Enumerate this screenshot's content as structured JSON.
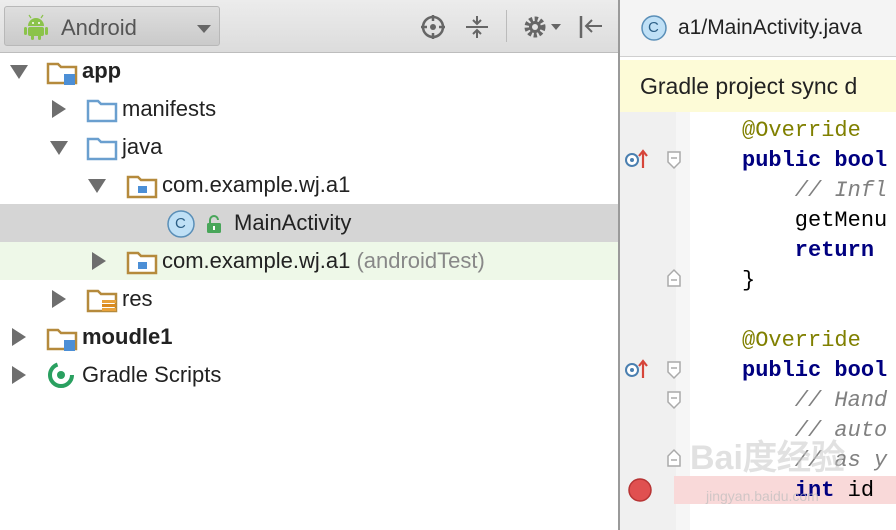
{
  "toolbar": {
    "view_mode": "Android"
  },
  "tree": {
    "rows": [
      {
        "label": "app",
        "extra": ""
      },
      {
        "label": "manifests",
        "extra": ""
      },
      {
        "label": "java",
        "extra": ""
      },
      {
        "label": "com.example.wj.a1",
        "extra": ""
      },
      {
        "label": "MainActivity",
        "extra": ""
      },
      {
        "label": "com.example.wj.a1",
        "extra": "(androidTest)"
      },
      {
        "label": "res",
        "extra": ""
      },
      {
        "label": "moudle1",
        "extra": ""
      },
      {
        "label": "Gradle Scripts",
        "extra": ""
      }
    ],
    "class_badge": "C"
  },
  "editor": {
    "tab_badge": "C",
    "tab_title": "a1/MainActivity.java",
    "banner": "Gradle project sync d",
    "lines": [
      "@Override",
      "public bool",
      "    // Infl",
      "    getMenu",
      "    return",
      "}",
      "@Override",
      "public bool",
      "    // Hand",
      "    // auto",
      "    // as y",
      "    int",
      " id"
    ]
  },
  "watermark": {
    "main": "Bai度经验",
    "sub": "jingyan.baidu.com"
  },
  "colors": {
    "selection": "#d5d5d5",
    "test_row": "#eef8e8",
    "keyword": "#000080",
    "annotation": "#808000",
    "comment": "#808080",
    "banner": "#fdfbd7",
    "breakpoint": "#e05050"
  }
}
